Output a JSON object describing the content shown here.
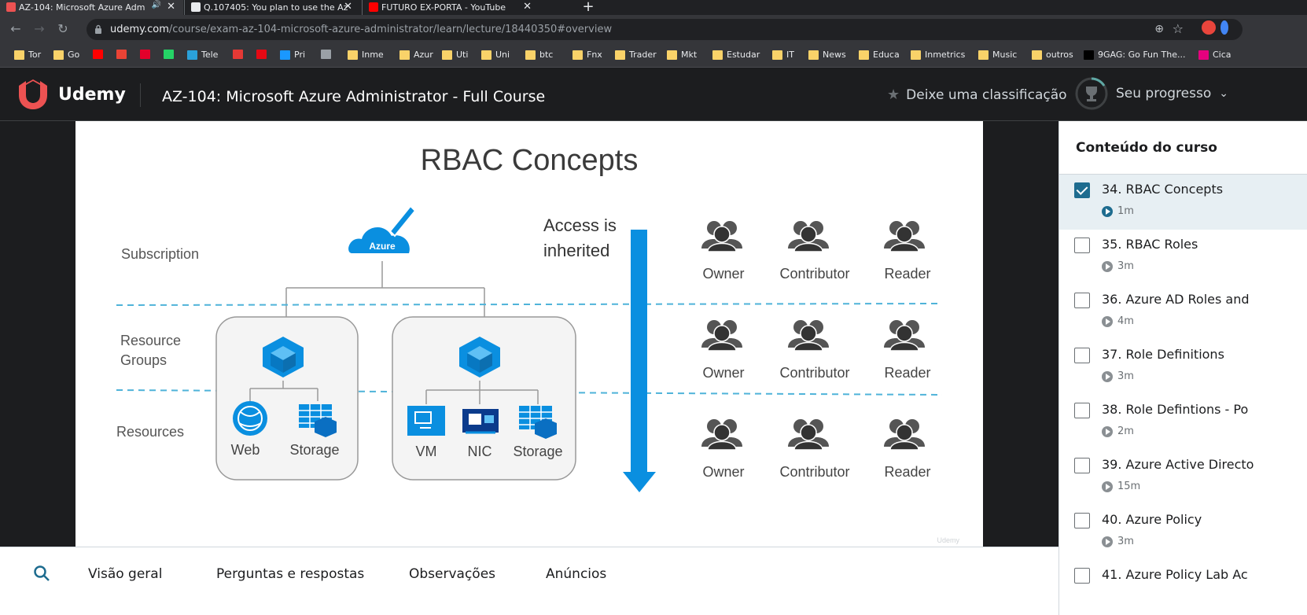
{
  "browser": {
    "tabs": [
      {
        "title": "AZ-104: Microsoft Azure Adm",
        "favicon_color": "#ec5252",
        "active": true
      },
      {
        "title": "Q.107405: You plan to use the Az",
        "favicon_color": "#e8eaed",
        "active": false
      },
      {
        "title": "FUTURO EX-PORTA - YouTube",
        "favicon_color": "#ff0000",
        "active": false
      }
    ],
    "address": {
      "host": "udemy.com",
      "path": "/course/exam-az-104-microsoft-azure-administrator/learn/lecture/18440350#overview"
    },
    "bookmarks": [
      {
        "label": "Tor",
        "icon": "folder-icon"
      },
      {
        "label": "Go",
        "icon": "folder-icon"
      },
      {
        "label": "",
        "icon": "youtube-icon"
      },
      {
        "label": "",
        "icon": "gmail-icon"
      },
      {
        "label": "",
        "icon": "podcast-icon"
      },
      {
        "label": "",
        "icon": "whatsapp-icon"
      },
      {
        "label": "Tele",
        "icon": "telegram-icon"
      },
      {
        "label": "",
        "icon": "simplefx-icon"
      },
      {
        "label": "",
        "icon": "netflix-icon"
      },
      {
        "label": "Pri",
        "icon": "prime-icon"
      },
      {
        "label": "",
        "icon": "download-icon"
      },
      {
        "label": "Inme",
        "icon": "folder-icon"
      },
      {
        "label": "Azur",
        "icon": "folder-icon"
      },
      {
        "label": "Uti",
        "icon": "folder-icon"
      },
      {
        "label": "Uni",
        "icon": "folder-icon"
      },
      {
        "label": "btc",
        "icon": "folder-icon"
      },
      {
        "label": "Fnx",
        "icon": "folder-icon"
      },
      {
        "label": "Trader",
        "icon": "folder-icon"
      },
      {
        "label": "Mkt",
        "icon": "folder-icon"
      },
      {
        "label": "Estudar",
        "icon": "folder-icon"
      },
      {
        "label": "IT",
        "icon": "folder-icon"
      },
      {
        "label": "News",
        "icon": "folder-icon"
      },
      {
        "label": "Educa",
        "icon": "folder-icon"
      },
      {
        "label": "Inmetrics",
        "icon": "folder-icon"
      },
      {
        "label": "Music",
        "icon": "folder-icon"
      },
      {
        "label": "outros",
        "icon": "folder-icon"
      },
      {
        "label": "9GAG: Go Fun The...",
        "icon": "9gag-icon"
      },
      {
        "label": "Cica",
        "icon": "s-icon"
      }
    ]
  },
  "header": {
    "brand": "Udemy",
    "course_title": "AZ-104: Microsoft Azure Administrator - Full Course",
    "rate_label": "Deixe uma classificação",
    "progress_label": "Seu progresso"
  },
  "slide": {
    "title": "RBAC Concepts",
    "levels": [
      "Subscription",
      "Resource",
      "Groups",
      "Resources"
    ],
    "azure_label": "Azure",
    "resources_left": [
      "Web",
      "Storage"
    ],
    "resources_right": [
      "VM",
      "NIC",
      "Storage"
    ],
    "access_text": [
      "Access is",
      "inherited"
    ],
    "roles": [
      "Owner",
      "Contributor",
      "Reader"
    ],
    "watermark": "Udemy"
  },
  "lecture_tabs": [
    "Visão geral",
    "Perguntas e respostas",
    "Observações",
    "Anúncios"
  ],
  "sidebar": {
    "heading": "Conteúdo do curso",
    "lectures": [
      {
        "title": "34. RBAC Concepts",
        "duration": "1m",
        "done": true,
        "active": true
      },
      {
        "title": "35. RBAC Roles",
        "duration": "3m",
        "done": false,
        "active": false
      },
      {
        "title": "36. Azure AD Roles and",
        "duration": "4m",
        "done": false,
        "active": false
      },
      {
        "title": "37. Role Definitions",
        "duration": "3m",
        "done": false,
        "active": false
      },
      {
        "title": "38. Role Defintions - Po",
        "duration": "2m",
        "done": false,
        "active": false
      },
      {
        "title": "39. Azure Active Directo",
        "duration": "15m",
        "done": false,
        "active": false
      },
      {
        "title": "40. Azure Policy",
        "duration": "3m",
        "done": false,
        "active": false
      },
      {
        "title": "41. Azure Policy Lab Ac",
        "duration": "",
        "done": false,
        "active": false
      }
    ]
  },
  "colors": {
    "udemy_red": "#ec5252",
    "azure_blue": "#0a8fe0",
    "active_row": "#e7eff3",
    "check_blue": "#1e6c8f"
  }
}
